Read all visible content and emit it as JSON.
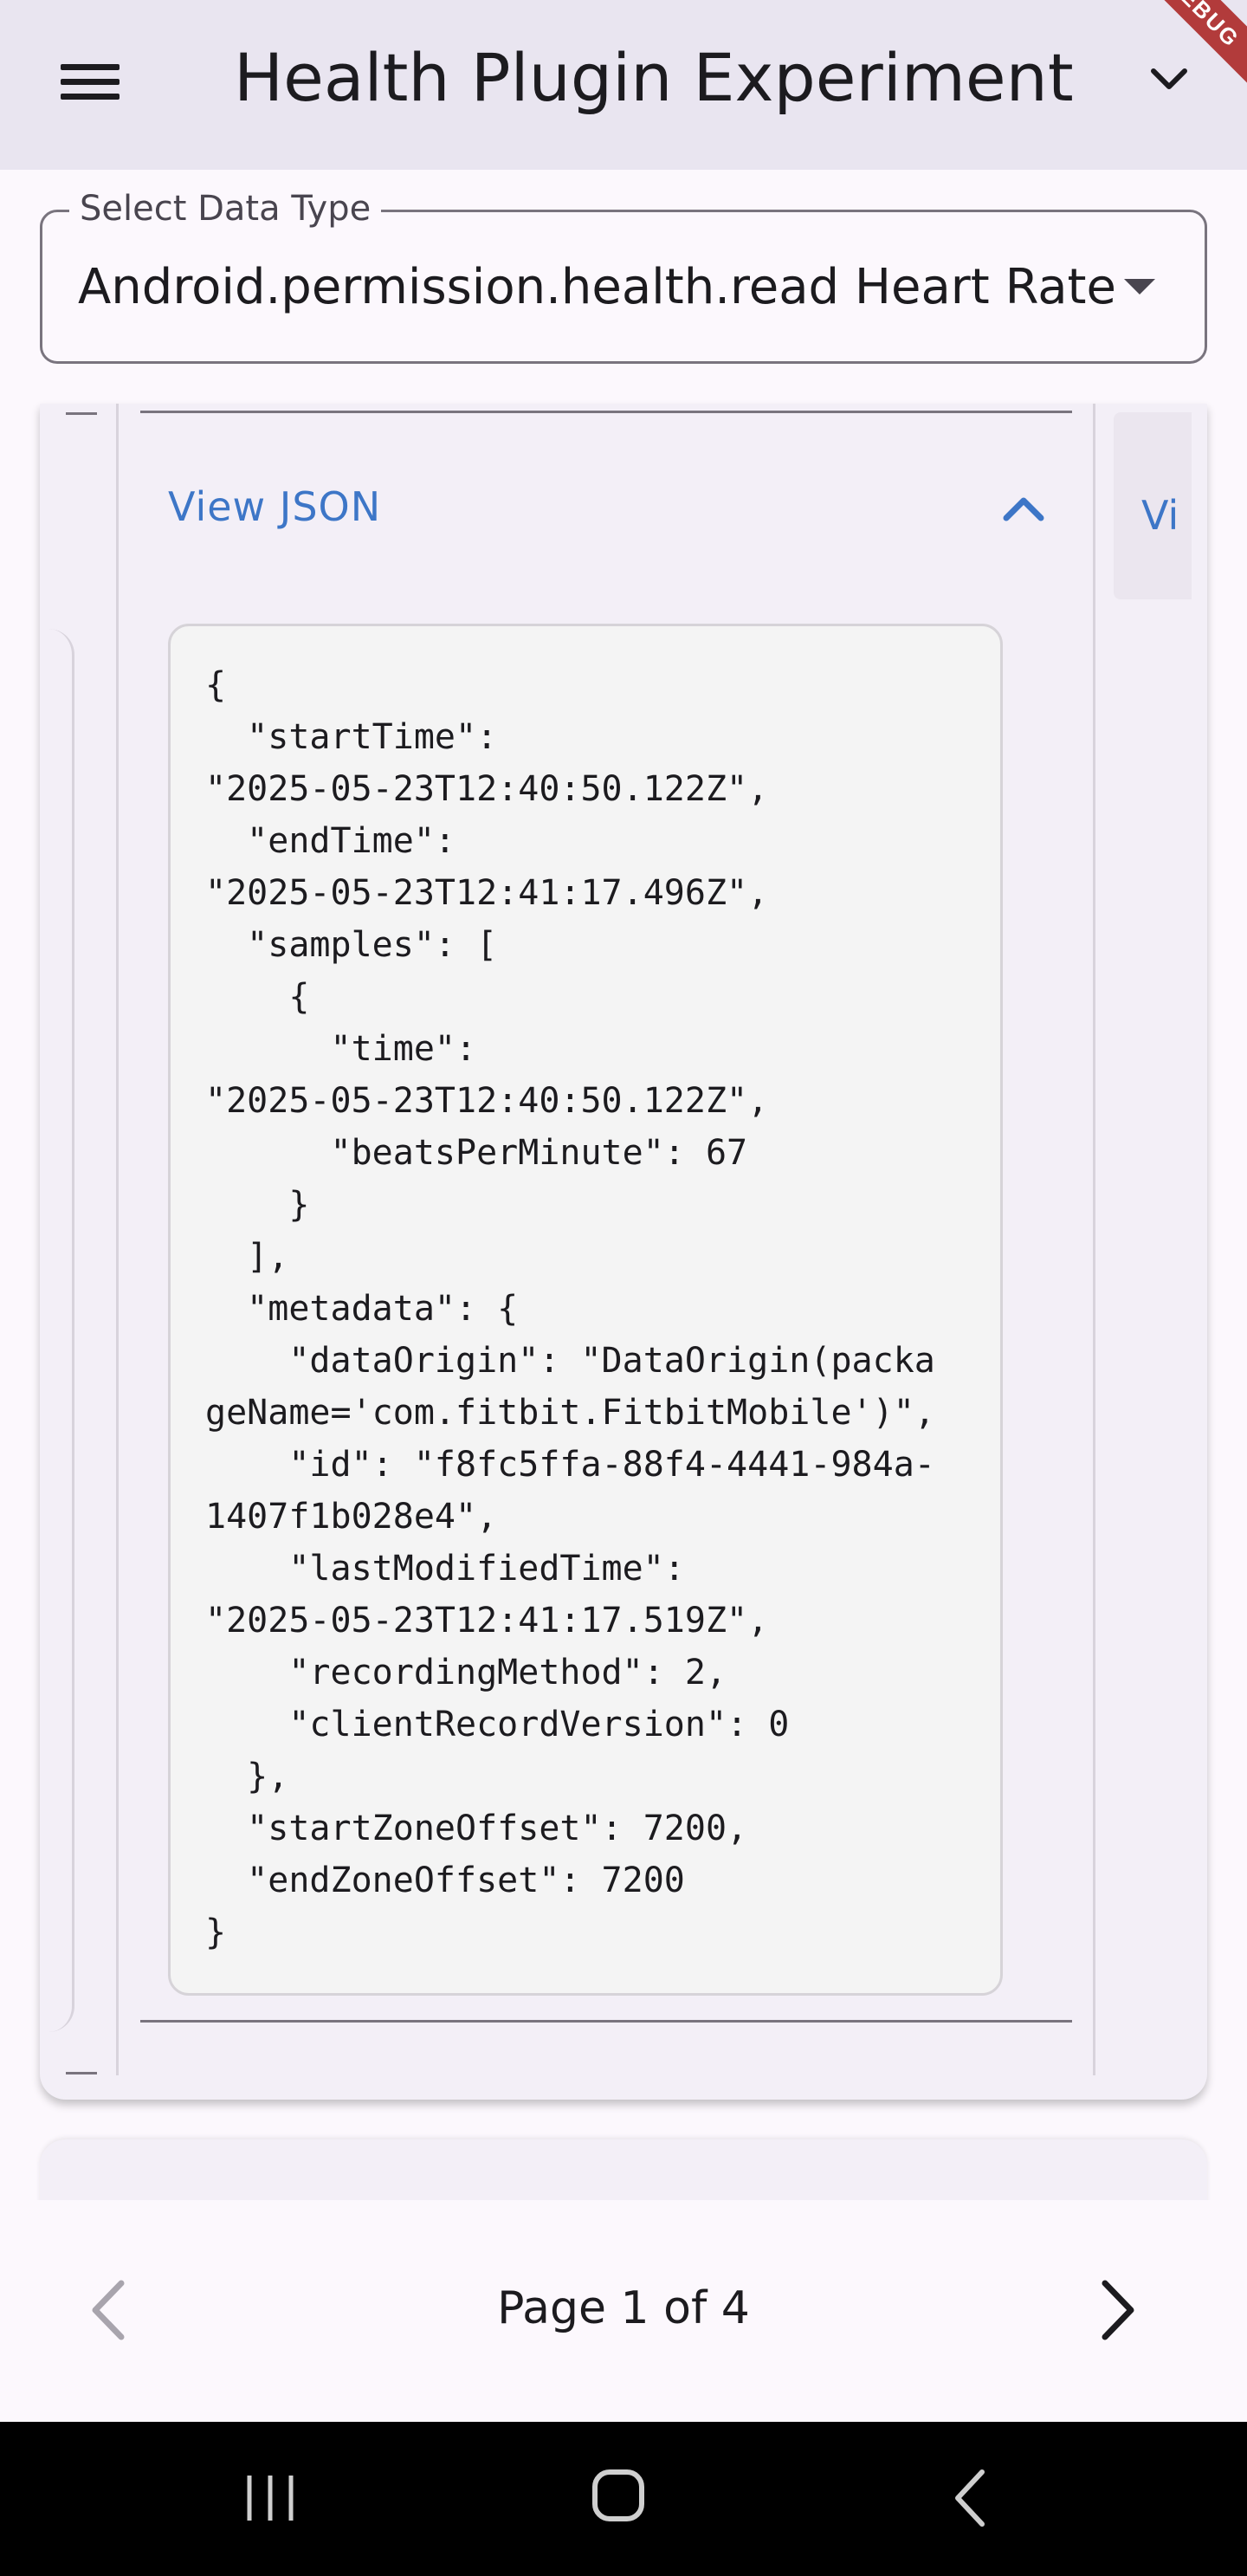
{
  "app_bar": {
    "title": "Health Plugin Experiment",
    "debug_banner": "DEBUG"
  },
  "data_type_select": {
    "label": "Select Data Type",
    "value": "Android.permission.health.read Heart Rate"
  },
  "record_card": {
    "view_json_label": "View JSON",
    "next_card_label": "Vi",
    "json_lines": [
      "{",
      "  \"startTime\":",
      "\"2025-05-23T12:40:50.122Z\",",
      "  \"endTime\":",
      "\"2025-05-23T12:41:17.496Z\",",
      "  \"samples\": [",
      "    {",
      "      \"time\":",
      "\"2025-05-23T12:40:50.122Z\",",
      "      \"beatsPerMinute\": 67",
      "    }",
      "  ],",
      "  \"metadata\": {",
      "    \"dataOrigin\": \"DataOrigin(packa",
      "geName='com.fitbit.FitbitMobile')\",",
      "    \"id\": \"f8fc5ffa-88f4-4441-984a-",
      "1407f1b028e4\",",
      "    \"lastModifiedTime\":",
      "\"2025-05-23T12:41:17.519Z\",",
      "    \"recordingMethod\": 2,",
      "    \"clientRecordVersion\": 0",
      "  },",
      "  \"startZoneOffset\": 7200,",
      "  \"endZoneOffset\": 7200",
      "}"
    ]
  },
  "pager": {
    "label": "Page 1 of 4",
    "current_page": 1,
    "total_pages": 4
  },
  "colors": {
    "app_bar_bg": "#e9e5f0",
    "link_blue": "#3d76c7",
    "json_bg": "#f4f4f4"
  },
  "icons": {
    "menu": "menu-icon",
    "app_bar_chevron": "chevron-down-icon",
    "dropdown": "dropdown-arrow-icon",
    "expand": "chevron-up-icon",
    "prev": "chevron-left-icon",
    "next": "chevron-right-icon",
    "sys_recents": "recents-icon",
    "sys_home": "home-icon",
    "sys_back": "back-icon"
  }
}
